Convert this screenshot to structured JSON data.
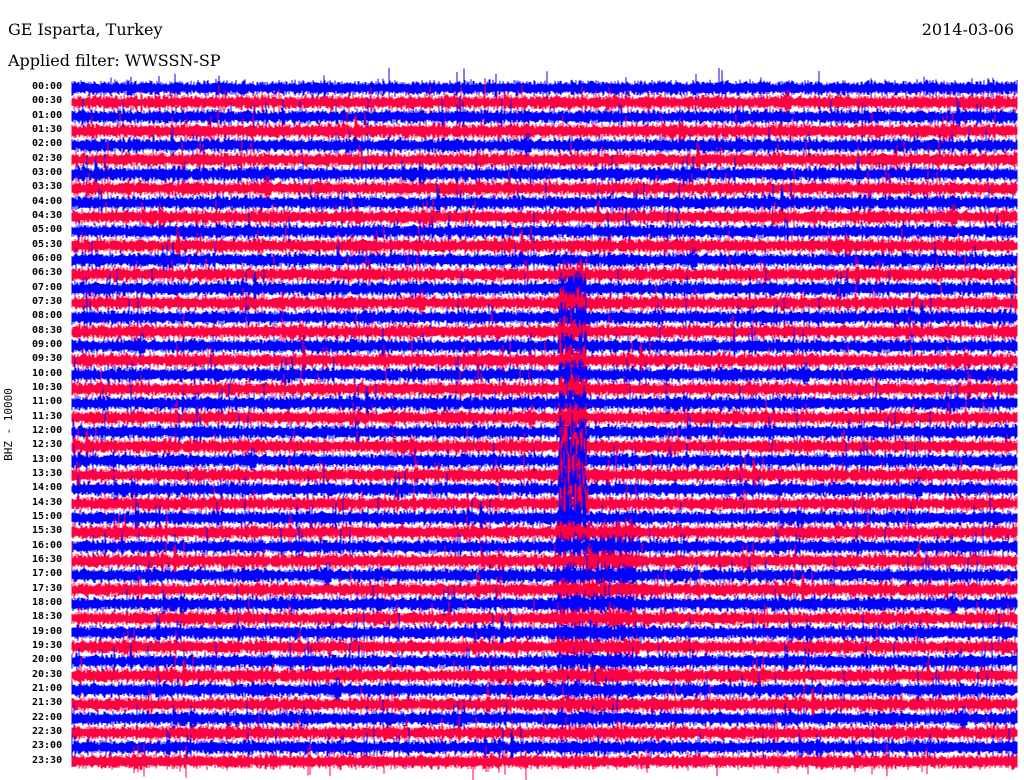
{
  "header": {
    "title": "GE Isparta, Turkey",
    "date": "2014-03-06",
    "filter": "Applied filter: WWSSN-SP"
  },
  "chart_data": {
    "type": "line",
    "title": "GE Isparta, Turkey",
    "subtitle": "Applied filter: WWSSN-SP",
    "ylabel": "BHZ - 10000",
    "xlabel": "",
    "row_minutes": 30,
    "row_labels": [
      "00:00",
      "00:30",
      "01:00",
      "01:30",
      "02:00",
      "02:30",
      "03:00",
      "03:30",
      "04:00",
      "04:30",
      "05:00",
      "05:30",
      "06:00",
      "06:30",
      "07:00",
      "07:30",
      "08:00",
      "08:30",
      "09:00",
      "09:30",
      "10:00",
      "10:30",
      "11:00",
      "11:30",
      "12:00",
      "12:30",
      "13:00",
      "13:30",
      "14:00",
      "14:30",
      "15:00",
      "15:30",
      "16:00",
      "16:30",
      "17:00",
      "17:30",
      "18:00",
      "18:30",
      "19:00",
      "19:30",
      "20:00",
      "20:30",
      "21:00",
      "21:30",
      "22:00",
      "22:30",
      "23:00",
      "23:30"
    ],
    "series_colors": [
      "#0000ff",
      "#ff0040"
    ],
    "event": {
      "row": "15:00",
      "minute": 16,
      "note": "large earthquake signal spanning rows ~06:30 to 15:00 amplitude"
    }
  }
}
